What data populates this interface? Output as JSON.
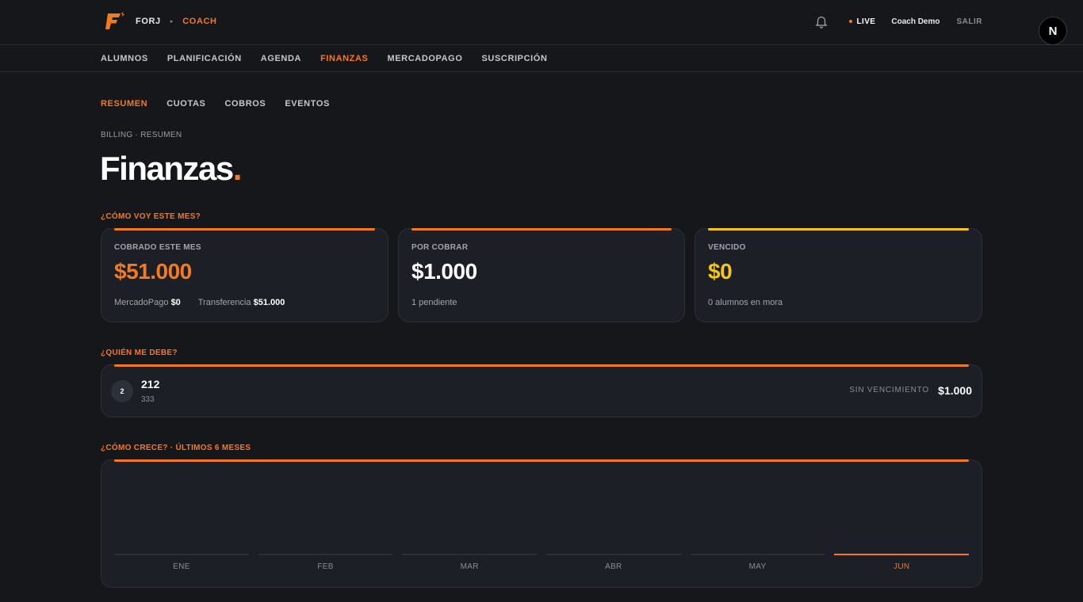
{
  "colors": {
    "accent": "#f47a1f",
    "warning": "#f5c518",
    "background": "#16171a",
    "card": "#1c1f25"
  },
  "header": {
    "app_name": "FORJ",
    "separator": "▸",
    "role": "COACH",
    "live_label": "LIVE",
    "user_name": "Coach Demo",
    "logout_label": "SALIR",
    "avatar_letter": "N"
  },
  "main_nav": {
    "items": [
      {
        "label": "ALUMNOS"
      },
      {
        "label": "PLANIFICACIÓN"
      },
      {
        "label": "AGENDA"
      },
      {
        "label": "FINANZAS"
      },
      {
        "label": "MERCADOPAGO"
      },
      {
        "label": "SUSCRIPCIÓN"
      }
    ],
    "active": "FINANZAS"
  },
  "sub_nav": {
    "items": [
      {
        "label": "RESUMEN"
      },
      {
        "label": "CUOTAS"
      },
      {
        "label": "COBROS"
      },
      {
        "label": "EVENTOS"
      }
    ],
    "active": "RESUMEN"
  },
  "page": {
    "breadcrumb": "BILLING · RESUMEN",
    "title": "Finanzas",
    "title_dot": "."
  },
  "summary": {
    "section_label": "¿CÓMO VOY ESTE MES?",
    "cards": [
      {
        "label": "COBRADO ESTE MES",
        "value": "$51.000",
        "sub_a_label": "MercadoPago",
        "sub_a_value": "$0",
        "sub_b_label": "Transferencia",
        "sub_b_value": "$51.000"
      },
      {
        "label": "POR COBRAR",
        "value": "$1.000",
        "sub": "1 pendiente"
      },
      {
        "label": "VENCIDO",
        "value": "$0",
        "sub": "0 alumnos en mora"
      }
    ]
  },
  "debtors": {
    "section_label": "¿QUIÉN ME DEBE?",
    "items": [
      {
        "initial": "2",
        "name": "212",
        "sub": "333",
        "due": "SIN VENCIMIENTO",
        "amount": "$1.000"
      }
    ]
  },
  "growth": {
    "section_label": "¿CÓMO CRECE? · ÚLTIMOS 6 MESES",
    "months": [
      "ENE",
      "FEB",
      "MAR",
      "ABR",
      "MAY",
      "JUN"
    ],
    "active_month": "JUN"
  }
}
